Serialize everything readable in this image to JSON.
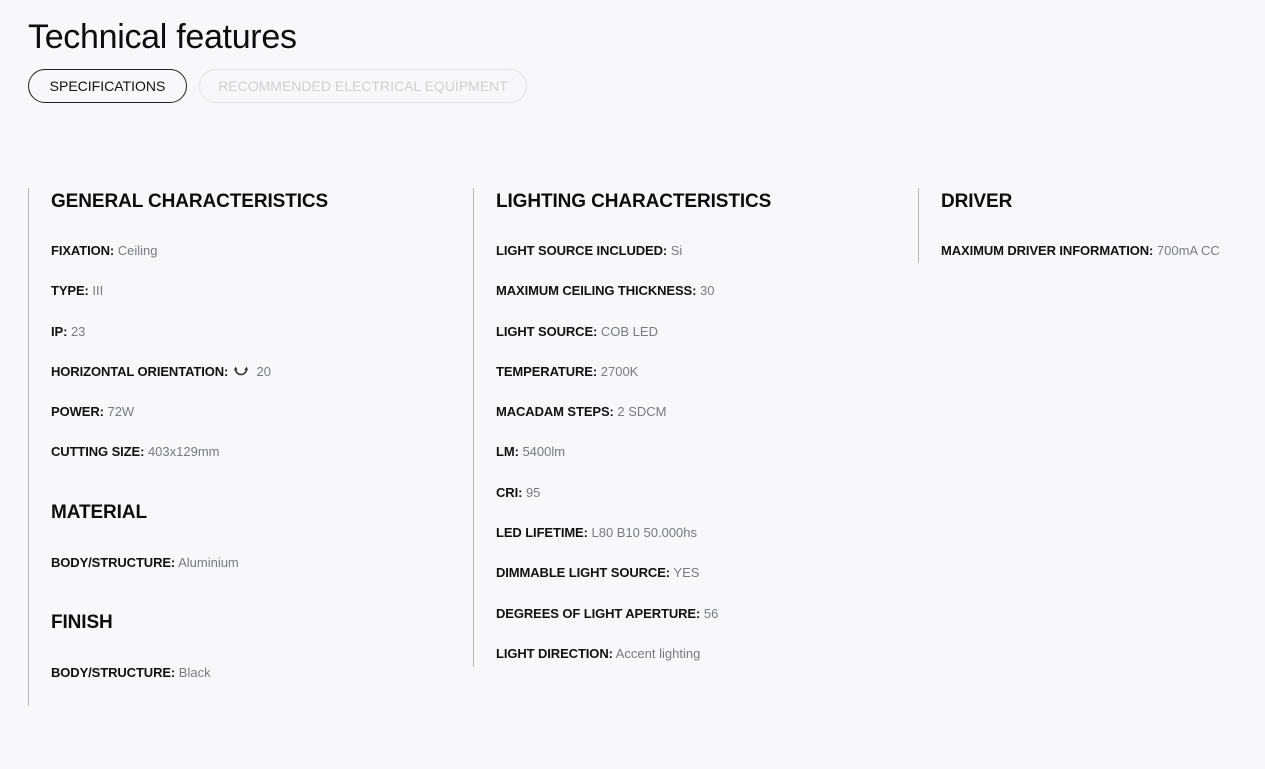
{
  "page": {
    "title": "Technical features"
  },
  "tabs": [
    {
      "label": "SPECIFICATIONS",
      "active": true
    },
    {
      "label": "RECOMMENDED ELECTRICAL EQUIPMENT",
      "active": false
    }
  ],
  "general": {
    "title": "GENERAL CHARACTERISTICS",
    "items": [
      {
        "label": "FIXATION:",
        "value": "Ceiling"
      },
      {
        "label": "TYPE:",
        "value": "III"
      },
      {
        "label": "IP:",
        "value": "23"
      },
      {
        "label": "HORIZONTAL ORIENTATION:",
        "value": "20",
        "icon": "rotation-arc-icon"
      },
      {
        "label": "POWER:",
        "value": "72W"
      },
      {
        "label": "CUTTING SIZE:",
        "value": "403x129mm"
      }
    ]
  },
  "material": {
    "title": "MATERIAL",
    "items": [
      {
        "label": "BODY/STRUCTURE:",
        "value": "Aluminium"
      }
    ]
  },
  "finish": {
    "title": "FINISH",
    "items": [
      {
        "label": "BODY/STRUCTURE:",
        "value": "Black"
      }
    ]
  },
  "lighting": {
    "title": "LIGHTING CHARACTERISTICS",
    "items": [
      {
        "label": "LIGHT SOURCE INCLUDED:",
        "value": "Si"
      },
      {
        "label": "MAXIMUM CEILING THICKNESS:",
        "value": "30"
      },
      {
        "label": "LIGHT SOURCE:",
        "value": "COB LED"
      },
      {
        "label": "TEMPERATURE:",
        "value": "2700K"
      },
      {
        "label": "MACADAM STEPS:",
        "value": "2 SDCM"
      },
      {
        "label": "LM:",
        "value": "5400lm"
      },
      {
        "label": "CRI:",
        "value": "95"
      },
      {
        "label": "LED LIFETIME:",
        "value": "L80 B10 50.000hs"
      },
      {
        "label": "DIMMABLE LIGHT SOURCE:",
        "value": "YES"
      },
      {
        "label": "DEGREES OF LIGHT APERTURE:",
        "value": "56"
      },
      {
        "label": "LIGHT DIRECTION:",
        "value": "Accent lighting"
      }
    ]
  },
  "driver": {
    "title": "DRIVER",
    "items": [
      {
        "label": "MAXIMUM DRIVER INFORMATION:",
        "value": "700mA CC"
      }
    ]
  },
  "colors": {
    "background": "#f8f8fa",
    "label": "#111111",
    "value": "#777a80",
    "divider": "#b8b8bc"
  }
}
